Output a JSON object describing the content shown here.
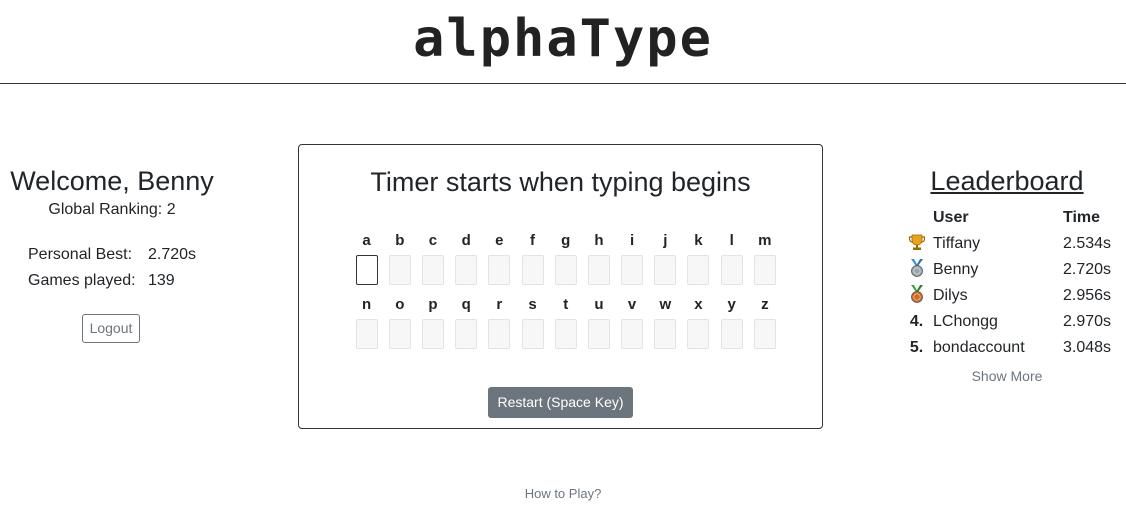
{
  "header": {
    "logo": "alphaType"
  },
  "welcome": {
    "title": "Welcome, Benny",
    "ranking": "Global Ranking: 2",
    "personal_best_label": "Personal Best:",
    "personal_best_value": "2.720s",
    "games_played_label": "Games played:",
    "games_played_value": "139",
    "logout_label": "Logout"
  },
  "game": {
    "timer_message": "Timer starts when typing begins",
    "row1": [
      "a",
      "b",
      "c",
      "d",
      "e",
      "f",
      "g",
      "h",
      "i",
      "j",
      "k",
      "l",
      "m"
    ],
    "row2": [
      "n",
      "o",
      "p",
      "q",
      "r",
      "s",
      "t",
      "u",
      "v",
      "w",
      "x",
      "y",
      "z"
    ],
    "restart_label": "Restart (Space Key)"
  },
  "leaderboard": {
    "title": "Leaderboard",
    "col_user": "User",
    "col_time": "Time",
    "entries": [
      {
        "rank": "1.",
        "medal": "gold-medal-icon",
        "user": "Tiffany",
        "time": "2.534s"
      },
      {
        "rank": "2.",
        "medal": "silver-medal-icon",
        "user": "Benny",
        "time": "2.720s"
      },
      {
        "rank": "3.",
        "medal": "bronze-medal-icon",
        "user": "Dilys",
        "time": "2.956s"
      },
      {
        "rank": "4.",
        "medal": "",
        "user": "LChongg",
        "time": "2.970s"
      },
      {
        "rank": "5.",
        "medal": "",
        "user": "bondaccount",
        "time": "3.048s"
      }
    ],
    "show_more_label": "Show More"
  },
  "footer": {
    "how_to_play": "How to Play?"
  },
  "colors": {
    "gold": "#e8a317",
    "silver": "#9aa5ad",
    "bronze": "#d2691e",
    "ribbon_green": "#3aa845",
    "ribbon_blue": "#3b8fd6",
    "button_gray": "#6c757d"
  }
}
